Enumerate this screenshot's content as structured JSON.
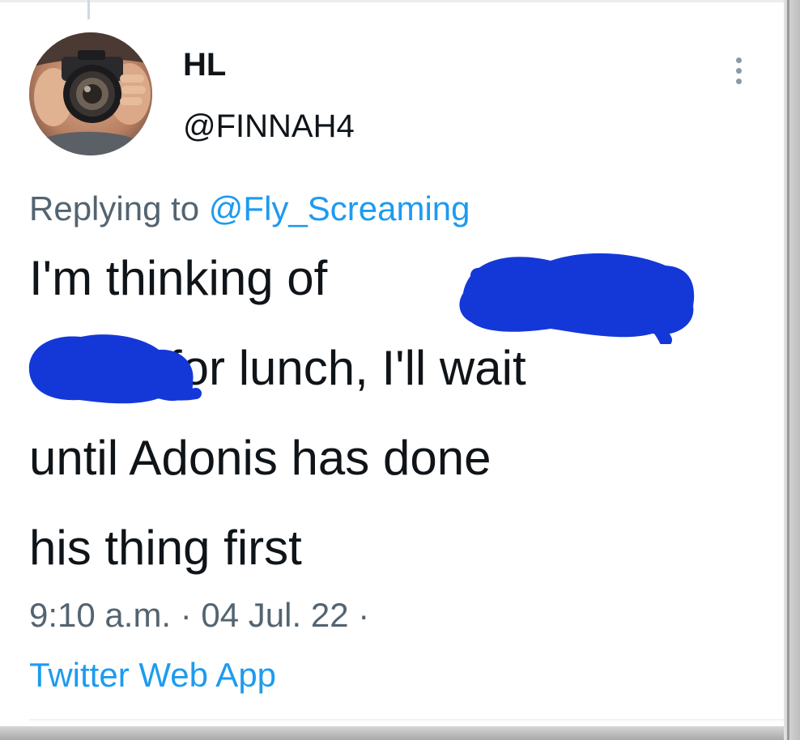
{
  "tweet": {
    "author": {
      "display_name": "HL",
      "handle": "@FINNAH4",
      "avatar_icon": "camera-photographer-avatar"
    },
    "reply": {
      "prefix": "Replying to ",
      "mention": "@Fly_Screaming"
    },
    "text_lines": [
      "I'm thinking of",
      "for lunch, I'll wait",
      "until Adonis has done",
      "his thing first"
    ],
    "redaction_color": "#1438d8",
    "timestamp": "9:10 a.m. · 04 Jul. 22 ·",
    "source": "Twitter Web App"
  },
  "colors": {
    "text_primary": "#0f1419",
    "text_secondary": "#536471",
    "link": "#1d9bf0"
  },
  "icons": {
    "more": "more-horizontal-dots-icon"
  }
}
